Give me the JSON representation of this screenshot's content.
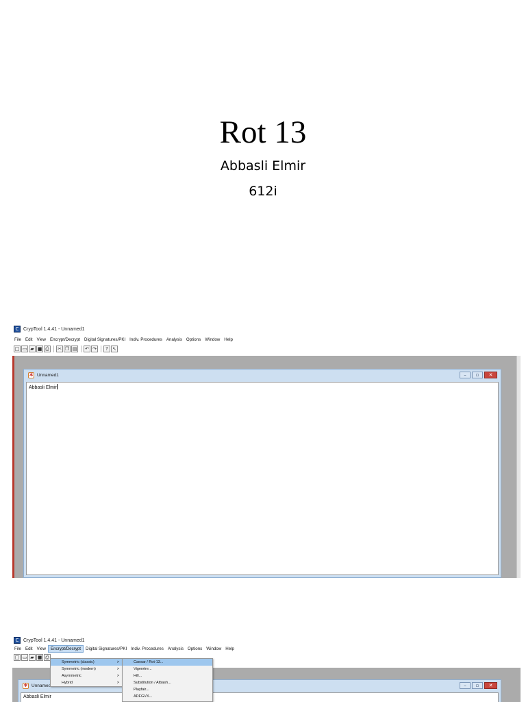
{
  "slide": {
    "title": "Rot 13",
    "author": "Abbasli Elmir",
    "group": "612i"
  },
  "shot1": {
    "titlebar": "CrypTool 1.4.41 - Unnamed1",
    "menu": [
      "File",
      "Edit",
      "View",
      "Encrypt/Decrypt",
      "Digital Signatures/PKI",
      "Indiv. Procedures",
      "Analysis",
      "Options",
      "Window",
      "Help"
    ],
    "child_title": "Unnamed1",
    "editor_text": "Abbasli Elmir"
  },
  "shot2": {
    "titlebar": "CrypTool 1.4.41 - Unnamed1",
    "menu": [
      "File",
      "Edit",
      "View",
      "Encrypt/Decrypt",
      "Digital Signatures/PKI",
      "Indiv. Procedures",
      "Analysis",
      "Options",
      "Window",
      "Help"
    ],
    "child_title": "Unnamed1",
    "editor_text": "Abbasli Elmir",
    "encrypt_menu": [
      "Symmetric (classic)",
      "Symmetric (modern)",
      "Asymmetric",
      "Hybrid"
    ],
    "classic_submenu": [
      "Caesar / Rot-13...",
      "Vigenère...",
      "Hill...",
      "Substitution / Atbash...",
      "Playfair...",
      "ADFGVX..."
    ]
  },
  "icons": {
    "toolbar": [
      "new-file-icon",
      "open-folder-icon",
      "open-icon",
      "save-icon",
      "print-icon",
      "cut-icon",
      "copy-icon",
      "paste-icon",
      "undo-icon",
      "redo-icon",
      "help-icon",
      "context-help-icon"
    ]
  }
}
